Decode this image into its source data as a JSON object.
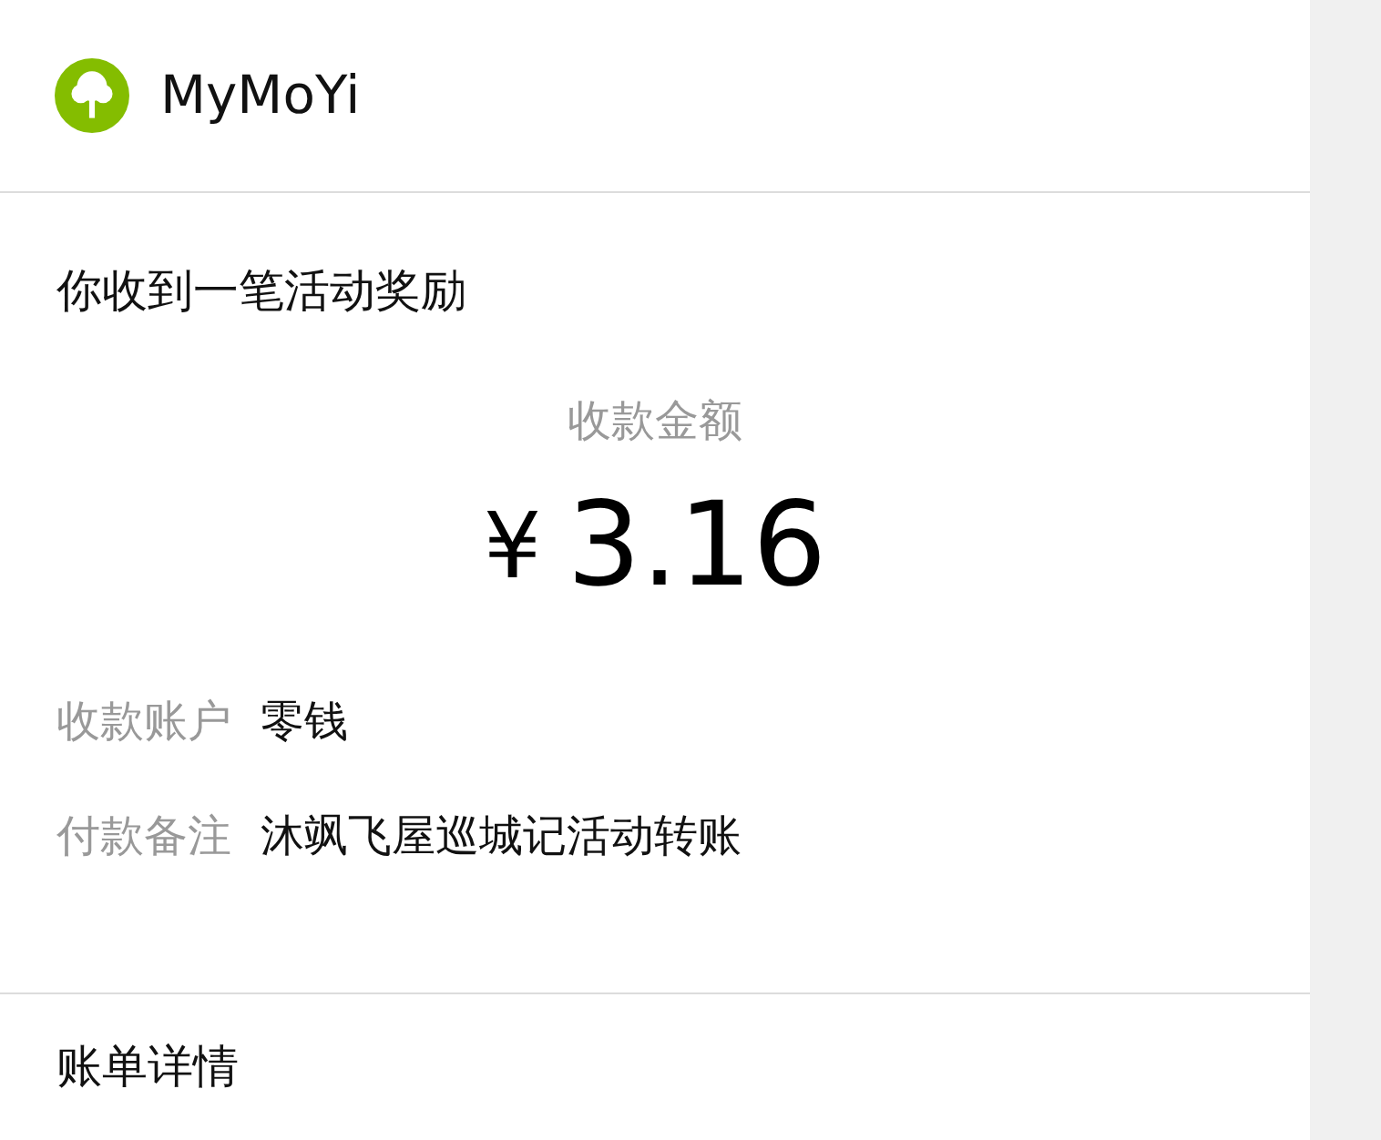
{
  "header": {
    "app_name": "MyMoYi"
  },
  "notice": {
    "title": "你收到一笔活动奖励",
    "amount_label": "收款金额",
    "currency": "¥",
    "amount": "3.16",
    "details": [
      {
        "label": "收款账户",
        "value": "零钱"
      },
      {
        "label": "付款备注",
        "value": "沐飒飞屋巡城记活动转账"
      }
    ]
  },
  "footer": {
    "link": "账单详情"
  }
}
